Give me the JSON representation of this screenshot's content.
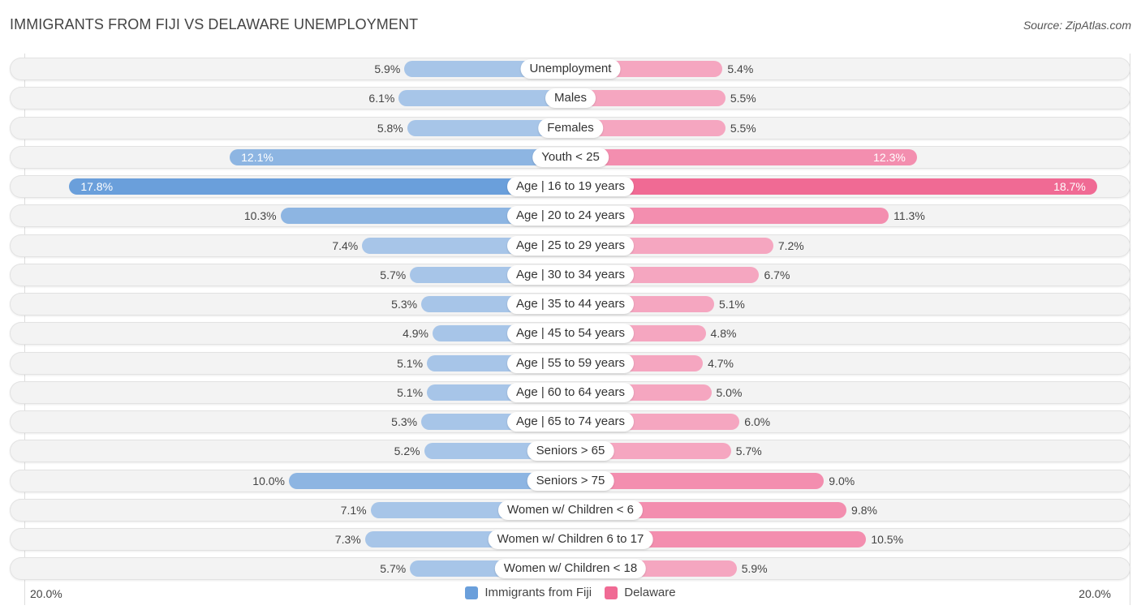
{
  "header": {
    "title": "IMMIGRANTS FROM FIJI VS DELAWARE UNEMPLOYMENT",
    "source": "Source: ZipAtlas.com"
  },
  "colors": {
    "fiji": "#6a9fdb",
    "delaware": "#f06a94"
  },
  "chart_data": {
    "type": "bar",
    "orientation": "horizontal-diverging",
    "title": "IMMIGRANTS FROM FIJI VS DELAWARE UNEMPLOYMENT",
    "categories": [
      "Unemployment",
      "Males",
      "Females",
      "Youth < 25",
      "Age | 16 to 19 years",
      "Age | 20 to 24 years",
      "Age | 25 to 29 years",
      "Age | 30 to 34 years",
      "Age | 35 to 44 years",
      "Age | 45 to 54 years",
      "Age | 55 to 59 years",
      "Age | 60 to 64 years",
      "Age | 65 to 74 years",
      "Seniors > 65",
      "Seniors > 75",
      "Women w/ Children < 6",
      "Women w/ Children 6 to 17",
      "Women w/ Children < 18"
    ],
    "series": [
      {
        "name": "Immigrants from Fiji",
        "side": "left",
        "values": [
          5.9,
          6.1,
          5.8,
          12.1,
          17.8,
          10.3,
          7.4,
          5.7,
          5.3,
          4.9,
          5.1,
          5.1,
          5.3,
          5.2,
          10.0,
          7.1,
          7.3,
          5.7
        ],
        "labels": [
          "5.9%",
          "6.1%",
          "5.8%",
          "12.1%",
          "17.8%",
          "10.3%",
          "7.4%",
          "5.7%",
          "5.3%",
          "4.9%",
          "5.1%",
          "5.1%",
          "5.3%",
          "5.2%",
          "10.0%",
          "7.1%",
          "7.3%",
          "5.7%"
        ]
      },
      {
        "name": "Delaware",
        "side": "right",
        "values": [
          5.4,
          5.5,
          5.5,
          12.3,
          18.7,
          11.3,
          7.2,
          6.7,
          5.1,
          4.8,
          4.7,
          5.0,
          6.0,
          5.7,
          9.0,
          9.8,
          10.5,
          5.9
        ],
        "labels": [
          "5.4%",
          "5.5%",
          "5.5%",
          "12.3%",
          "18.7%",
          "11.3%",
          "7.2%",
          "6.7%",
          "5.1%",
          "4.8%",
          "4.7%",
          "5.0%",
          "6.0%",
          "5.7%",
          "9.0%",
          "9.8%",
          "10.5%",
          "5.9%"
        ]
      }
    ],
    "xlim": [
      0,
      20
    ],
    "axis_labels": {
      "left": "20.0%",
      "right": "20.0%"
    },
    "legend": [
      "Immigrants from Fiji",
      "Delaware"
    ],
    "legend_position": "bottom-center",
    "unit": "%"
  }
}
